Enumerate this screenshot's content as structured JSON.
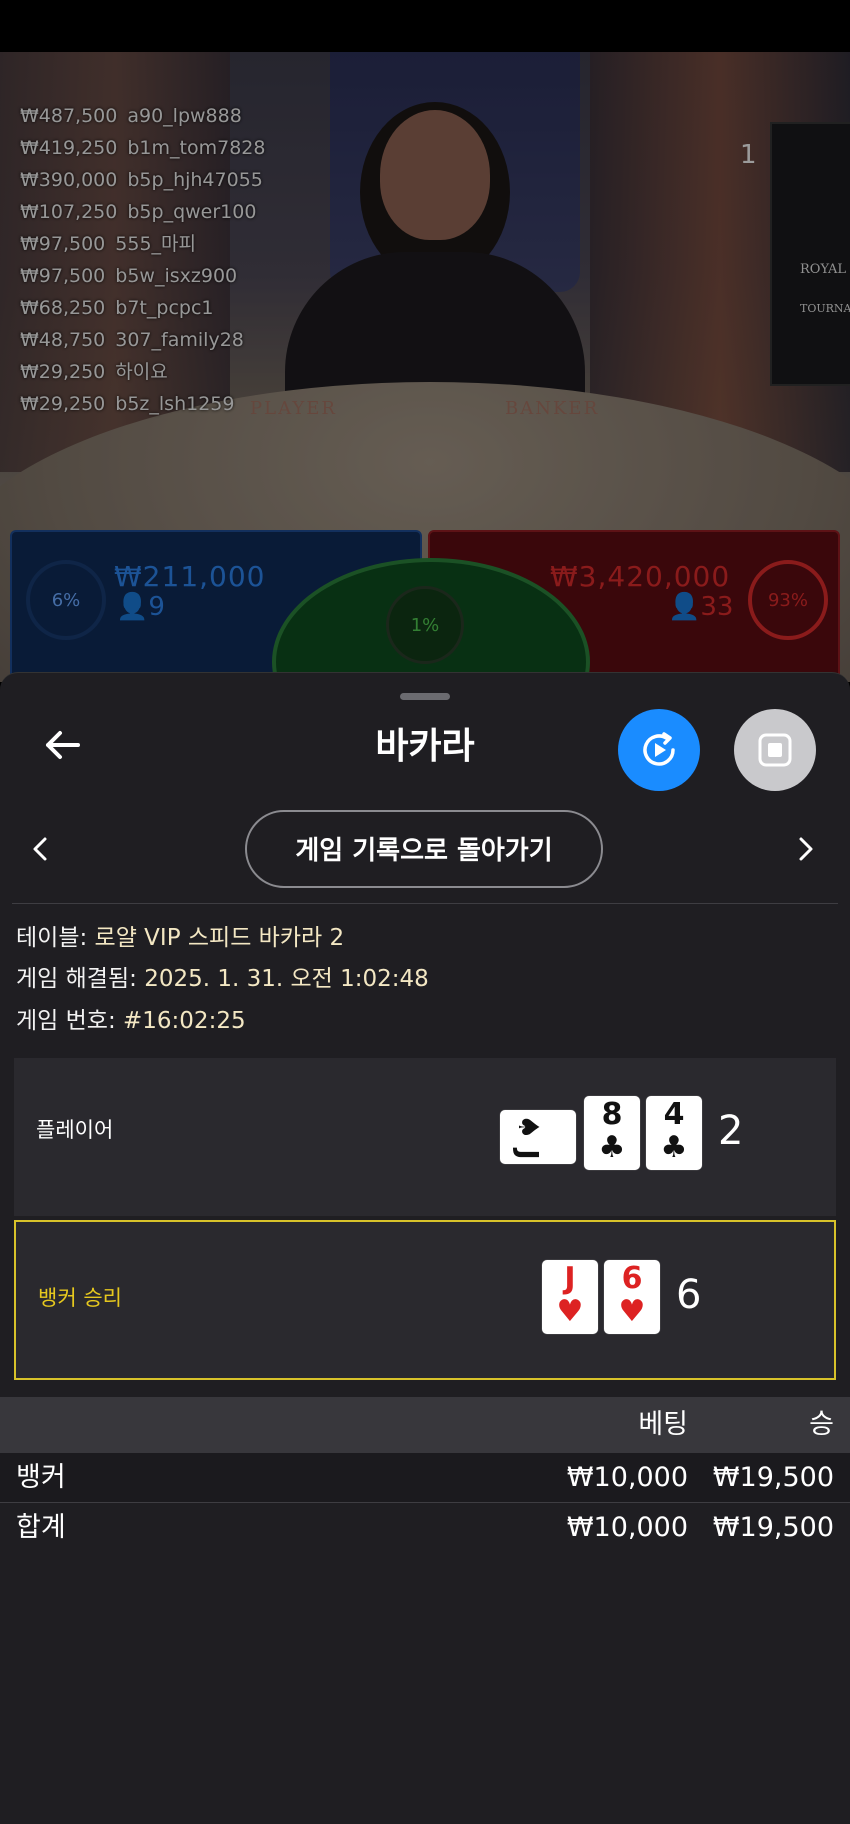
{
  "video": {
    "winners": [
      {
        "amount": "₩487,500",
        "user": "a90_lpw888"
      },
      {
        "amount": "₩419,250",
        "user": "b1m_tom7828"
      },
      {
        "amount": "₩390,000",
        "user": "b5p_hjh47055"
      },
      {
        "amount": "₩107,250",
        "user": "b5p_qwer100"
      },
      {
        "amount": "₩97,500",
        "user": "555_마피"
      },
      {
        "amount": "₩97,500",
        "user": "b5w_isxz900"
      },
      {
        "amount": "₩68,250",
        "user": "b7t_pcpc1"
      },
      {
        "amount": "₩48,750",
        "user": "307_family28"
      },
      {
        "amount": "₩29,250",
        "user": "하이요"
      },
      {
        "amount": "₩29,250",
        "user": "b5z_lsh1259"
      }
    ],
    "table_labels": {
      "player": "PLAYER",
      "banker": "BANKER"
    },
    "monitor_text": "ROYAL",
    "monitor_sub": "TOURNA",
    "seat_number": "1",
    "player_bets": {
      "percent": "6%",
      "amount": "₩211,000",
      "count": "9",
      "color": "#1e6fd0"
    },
    "banker_bets": {
      "percent": "93%",
      "amount": "₩3,420,000",
      "count": "33",
      "color": "#d42a2a"
    },
    "tie_bets": {
      "percent": "1%",
      "color": "#2e9d3a"
    }
  },
  "header": {
    "back_icon": "arrow-left-icon",
    "title": "바카라",
    "replay_icon": "replay-icon",
    "stop_icon": "stop-icon",
    "accent": "#1a8cff"
  },
  "nav": {
    "prev_icon": "chevron-left-icon",
    "next_icon": "chevron-right-icon",
    "back_to_history_label": "게임 기록으로 돌아가기"
  },
  "details": {
    "table_label": "테이블:",
    "table_value": "로얄 VIP 스피드 바카라 2",
    "resolved_label": "게임 해결됨:",
    "resolved_value": "2025. 1. 31. 오전 1:02:48",
    "number_label": "게임 번호:",
    "number_value": "#16:02:25"
  },
  "result": {
    "player": {
      "label": "플레이어",
      "cards": [
        {
          "rank": "J",
          "suit": "♠",
          "orientation": "sideways"
        },
        {
          "rank": "8",
          "suit": "♣"
        },
        {
          "rank": "4",
          "suit": "♣"
        }
      ],
      "score": "2"
    },
    "banker": {
      "label": "뱅커 승리",
      "label_color": "#e6c81e",
      "cards": [
        {
          "rank": "J",
          "suit": "♥"
        },
        {
          "rank": "6",
          "suit": "♥"
        }
      ],
      "score": "6"
    }
  },
  "bets_table": {
    "headers": {
      "bet": "베팅",
      "win": "승"
    },
    "rows": [
      {
        "name": "뱅커",
        "bet": "₩10,000",
        "win": "₩19,500"
      },
      {
        "name": "합계",
        "bet": "₩10,000",
        "win": "₩19,500"
      }
    ]
  }
}
